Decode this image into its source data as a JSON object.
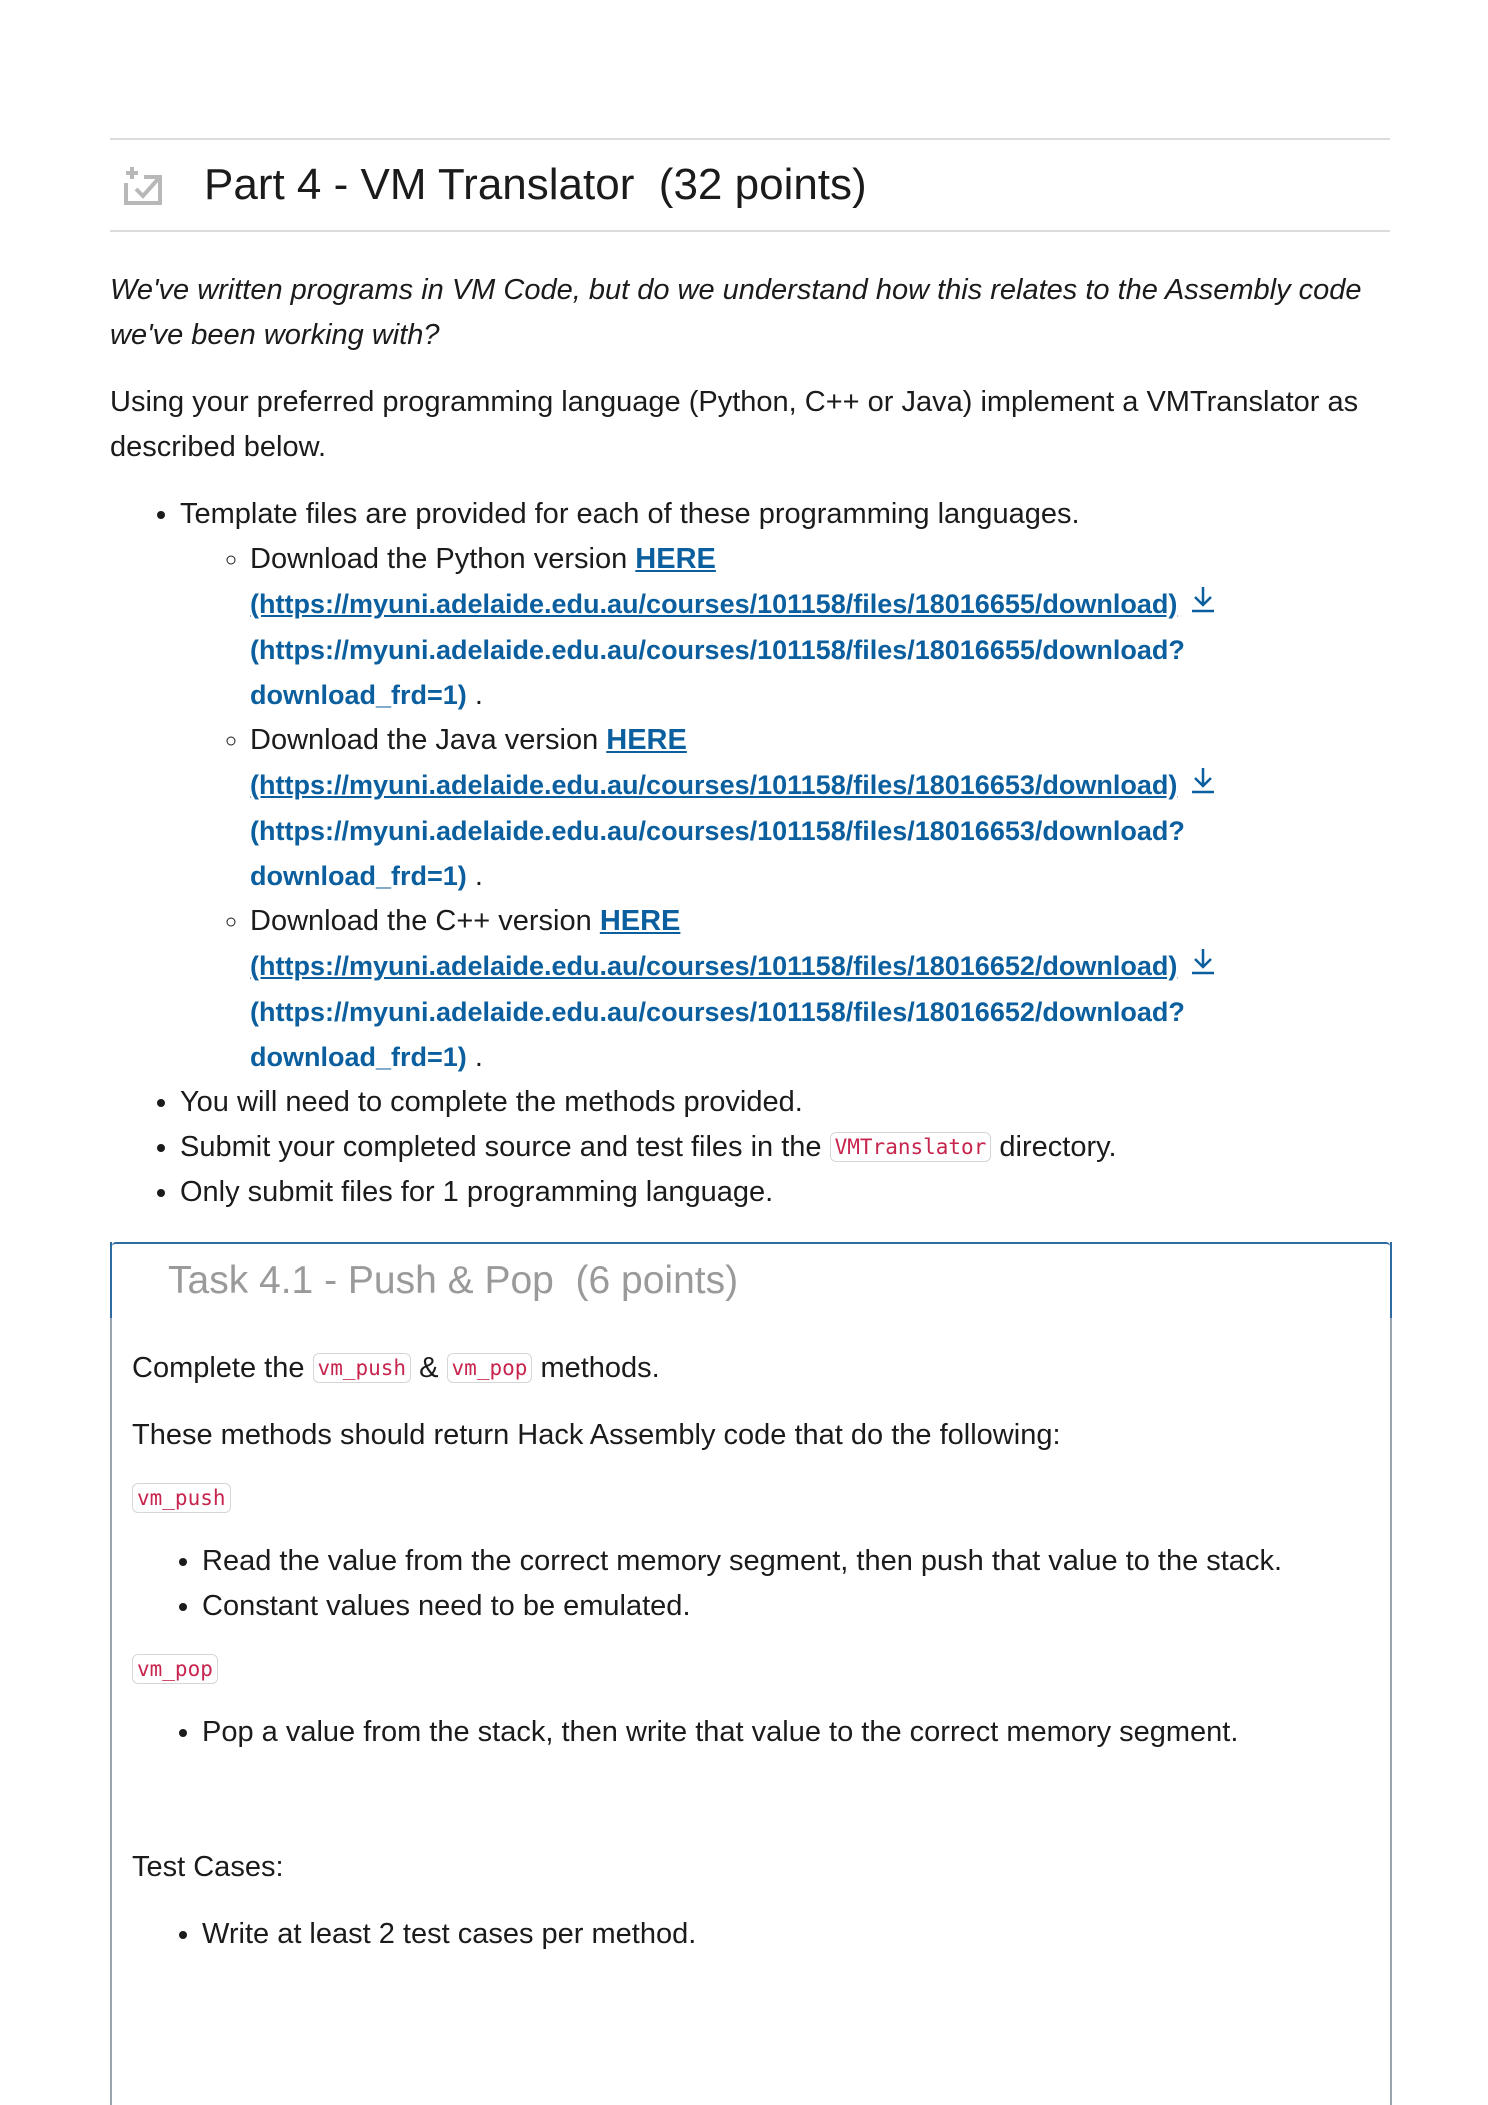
{
  "header": {
    "title": "Part 4 - VM Translator  (32 points)",
    "icon": "assignment-checklist-icon"
  },
  "intro": "We've written programs in VM Code, but do we understand how this relates to the Assembly code we've been working with?",
  "description": "Using your preferred programming language (Python, C++ or Java) implement a VMTranslator as described below.",
  "bullets": {
    "templates": "Template files are provided for each of these programming languages.",
    "downloads": [
      {
        "prefix": "Download the Python version ",
        "here": "HERE",
        "url1": "(https://myuni.adelaide.edu.au/courses/101158/files/18016655/download)",
        "url2": "(https://myuni.adelaide.edu.au/courses/101158/files/18016655/download?",
        "url3": "download_frd=1)",
        "suffix": " ."
      },
      {
        "prefix": "Download the Java version ",
        "here": "HERE",
        "url1": "(https://myuni.adelaide.edu.au/courses/101158/files/18016653/download)",
        "url2": "(https://myuni.adelaide.edu.au/courses/101158/files/18016653/download?",
        "url3": "download_frd=1)",
        "suffix": " ."
      },
      {
        "prefix": "Download the C++ version ",
        "here": "HERE",
        "url1": "(https://myuni.adelaide.edu.au/courses/101158/files/18016652/download)",
        "url2": "(https://myuni.adelaide.edu.au/courses/101158/files/18016652/download?",
        "url3": "download_frd=1)",
        "suffix": " ."
      }
    ],
    "complete_methods": "You will need to complete the methods provided.",
    "submit_prefix": "Submit your completed source and test files in the ",
    "submit_code": "VMTranslator",
    "submit_suffix": " directory.",
    "only_submit": "Only submit files for 1 programming language."
  },
  "task": {
    "title": "Task 4.1 - Push & Pop  (6 points)",
    "complete_prefix": "Complete the ",
    "code_push": "vm_push",
    "amp": " & ",
    "code_pop": "vm_pop",
    "complete_suffix": " methods.",
    "methods_desc": "These methods should return Hack Assembly code that do the following:",
    "push_items": [
      "Read the value from the correct memory segment, then push that value to the stack.",
      "Constant values need to be emulated."
    ],
    "pop_items": [
      "Pop a value from the stack, then write that value to the correct memory segment."
    ],
    "test_cases_label": "Test Cases:",
    "test_items": [
      "Write at least 2 test cases per method."
    ]
  },
  "colors": {
    "link": "#0b5f9e",
    "code": "#c7254e",
    "task_border": "#2d6ca2",
    "task_title": "#9a9a9a"
  }
}
